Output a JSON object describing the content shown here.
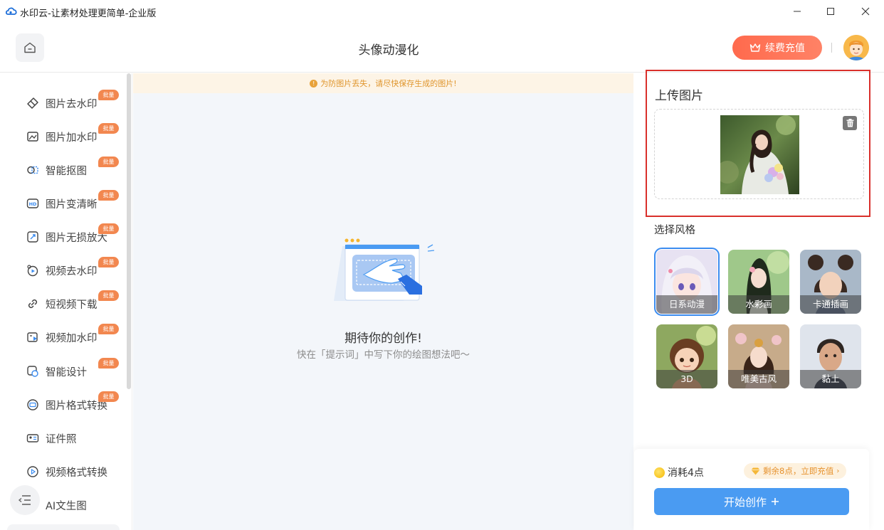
{
  "window": {
    "title": "水印云-让素材处理更简单-企业版",
    "controls": {
      "minimize": "—",
      "maximize": "☐",
      "close": "✕"
    }
  },
  "header": {
    "title": "头像动漫化",
    "recharge_label": "续费充值",
    "home_icon": "home-icon",
    "avatar_icon": "user-avatar"
  },
  "sidebar": {
    "items": [
      {
        "label": "图片去水印",
        "badge": "批量",
        "icon": "eraser-icon"
      },
      {
        "label": "图片加水印",
        "badge": "批量",
        "icon": "image-add-icon"
      },
      {
        "label": "智能抠图",
        "badge": "批量",
        "icon": "cutout-icon"
      },
      {
        "label": "图片变清晰",
        "badge": "批量",
        "icon": "hd-icon"
      },
      {
        "label": "图片无损放大",
        "badge": "批量",
        "icon": "enlarge-icon"
      },
      {
        "label": "视频去水印",
        "badge": "批量",
        "icon": "video-eraser-icon"
      },
      {
        "label": "短视频下载",
        "badge": "批量",
        "icon": "link-icon"
      },
      {
        "label": "视频加水印",
        "badge": "批量",
        "icon": "video-add-icon"
      },
      {
        "label": "智能设计",
        "badge": "批量",
        "icon": "design-icon"
      },
      {
        "label": "图片格式转换",
        "badge": "批量",
        "icon": "format-icon"
      },
      {
        "label": "证件照",
        "badge": "",
        "icon": "id-photo-icon"
      },
      {
        "label": "视频格式转换",
        "badge": "",
        "icon": "play-icon"
      },
      {
        "label": "AI文生图",
        "badge": "",
        "icon": "ai-image-icon"
      }
    ]
  },
  "center": {
    "notice": "为防图片丢失，请尽快保存生成的图片!",
    "empty_title": "期待你的创作!",
    "empty_subtitle": "快在「提示词」中写下你的绘图想法吧～"
  },
  "right": {
    "upload_title": "上传图片",
    "style_title": "选择风格",
    "styles": [
      {
        "label": "日系动漫",
        "selected": true
      },
      {
        "label": "水彩画",
        "selected": false
      },
      {
        "label": "卡通插画",
        "selected": false
      },
      {
        "label": "3D",
        "selected": false
      },
      {
        "label": "唯美古风",
        "selected": false
      },
      {
        "label": "黏土",
        "selected": false
      }
    ],
    "cost_label": "消耗4点",
    "remain_label": "剩余8点，立即充值",
    "start_label": "开始创作"
  },
  "colors": {
    "accent_blue": "#4a9bf2",
    "recharge_orange": "#ff6a4d",
    "badge_orange": "#f2874f",
    "highlight_red": "#d9302b"
  }
}
